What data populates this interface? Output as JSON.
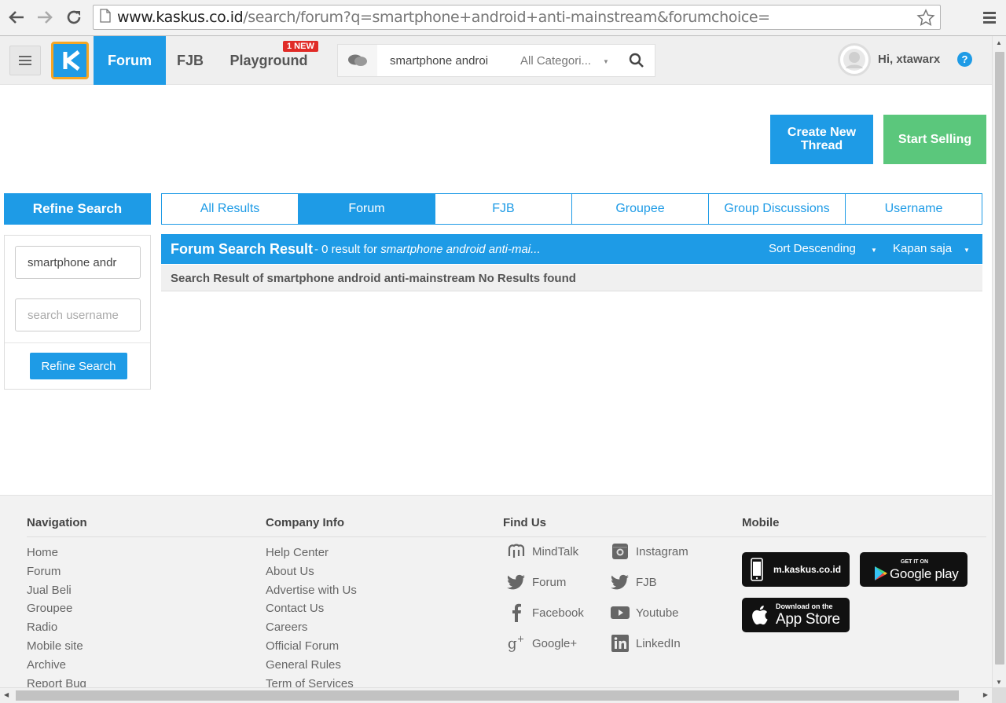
{
  "browser": {
    "url_host": "www.kaskus.co.id",
    "url_path": "/search/forum?q=smartphone+android+anti-mainstream&forumchoice="
  },
  "header": {
    "tabs": [
      "Forum",
      "FJB",
      "Playground"
    ],
    "new_badge": "1 NEW",
    "search_value": "smartphone androi",
    "category": "All Categori...",
    "greeting": "Hi, xtawarx",
    "help": "?"
  },
  "actions": {
    "create_thread": "Create New Thread",
    "start_selling": "Start Selling"
  },
  "refine": {
    "title": "Refine Search",
    "keyword_value": "smartphone andr",
    "username_placeholder": "search username",
    "button": "Refine Search"
  },
  "result_tabs": [
    "All Results",
    "Forum",
    "FJB",
    "Groupee",
    "Group Discussions",
    "Username"
  ],
  "results": {
    "title": "Forum Search Result",
    "count_text": "- 0 result for",
    "query_italic": "smartphone android anti-mai...",
    "sort": "Sort Descending",
    "time": "Kapan saja",
    "empty_message": "Search Result of smartphone android anti-mainstream No Results found"
  },
  "footer": {
    "navigation": {
      "title": "Navigation",
      "links": [
        "Home",
        "Forum",
        "Jual Beli",
        "Groupee",
        "Radio",
        "Mobile site",
        "Archive",
        "Report Bug"
      ]
    },
    "company": {
      "title": "Company Info",
      "links": [
        "Help Center",
        "About Us",
        "Advertise with Us",
        "Contact Us",
        "Careers",
        "Official Forum",
        "General Rules",
        "Term of Services"
      ]
    },
    "find_us": {
      "title": "Find Us",
      "left": [
        "MindTalk",
        "Forum",
        "Facebook",
        "Google+"
      ],
      "right": [
        "Instagram",
        "FJB",
        "Youtube",
        "LinkedIn"
      ]
    },
    "mobile": {
      "title": "Mobile",
      "site_badge": "m.kaskus.co.id",
      "google_small": "GET IT ON",
      "google_big": "Google play",
      "apple_small": "Download on the",
      "apple_big": "App Store"
    }
  },
  "colors": {
    "primary": "#1e9be6",
    "sell_green": "#5bc77c",
    "logo_border": "#f5a623",
    "badge_red": "#e02b27"
  }
}
